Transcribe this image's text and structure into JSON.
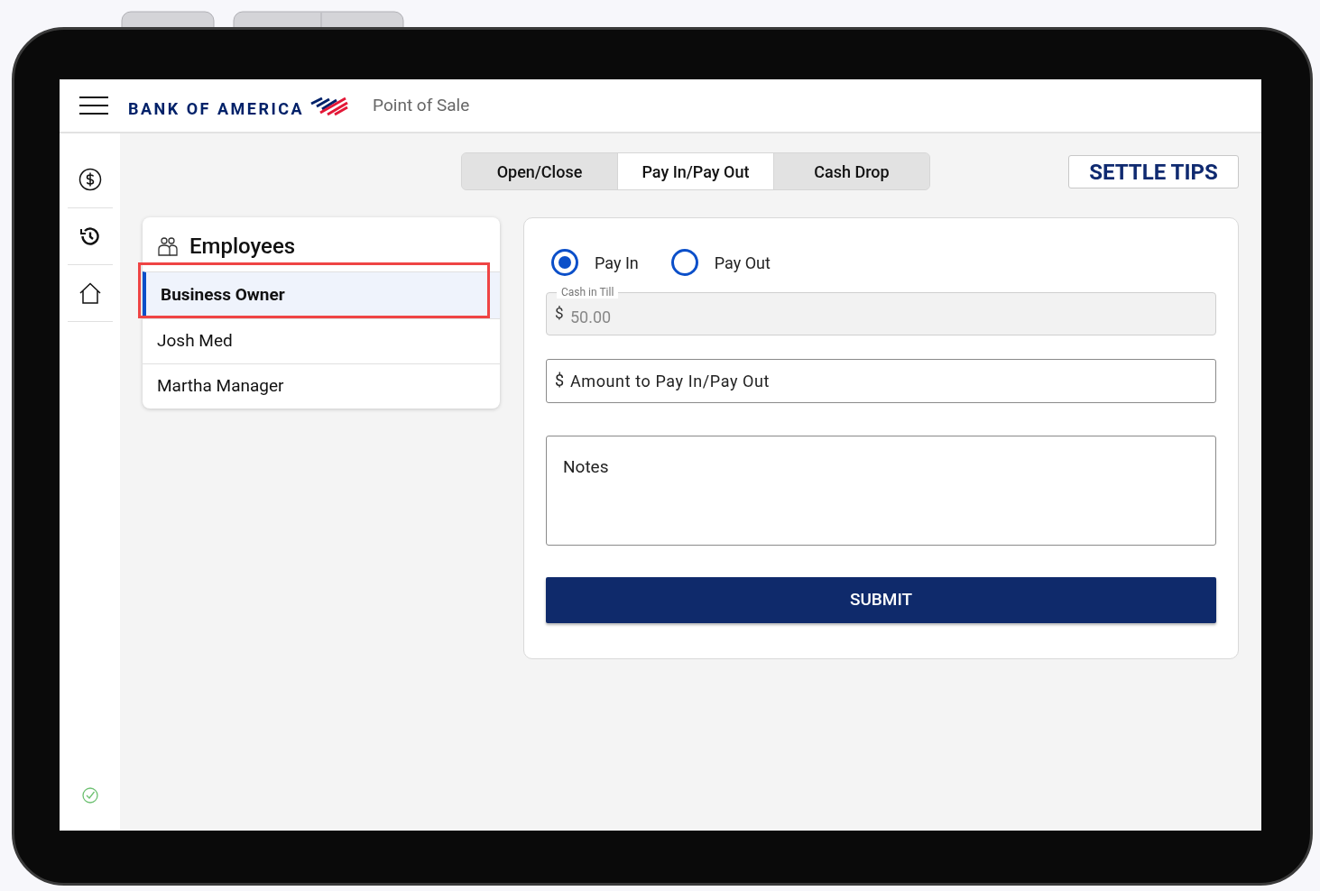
{
  "header": {
    "brand": "BANK OF AMERICA",
    "app_title": "Point of Sale"
  },
  "sidebar": {
    "items": [
      {
        "kind": "dollar"
      },
      {
        "kind": "history"
      },
      {
        "kind": "home"
      }
    ],
    "status": {
      "kind": "ok"
    }
  },
  "tabs": [
    {
      "label": "Open/Close",
      "selected": false
    },
    {
      "label": "Pay In/Pay Out",
      "selected": true
    },
    {
      "label": "Cash Drop",
      "selected": false
    }
  ],
  "settle_button": "SETTLE TIPS",
  "employees": {
    "title": "Employees",
    "items": [
      {
        "name": "Business Owner",
        "selected": true,
        "highlighted": true
      },
      {
        "name": "Josh Med",
        "selected": false,
        "highlighted": false
      },
      {
        "name": "Martha Manager",
        "selected": false,
        "highlighted": false
      }
    ]
  },
  "form": {
    "options": [
      {
        "label": "Pay In",
        "selected": true
      },
      {
        "label": "Pay Out",
        "selected": false
      }
    ],
    "cash_in_till": {
      "label": "Cash in Till",
      "prefix": "$",
      "value": "50.00",
      "disabled": true
    },
    "amount": {
      "prefix": "$",
      "placeholder": "Amount to Pay In/Pay Out"
    },
    "notes": {
      "placeholder": "Notes"
    },
    "submit": "SUBMIT"
  }
}
